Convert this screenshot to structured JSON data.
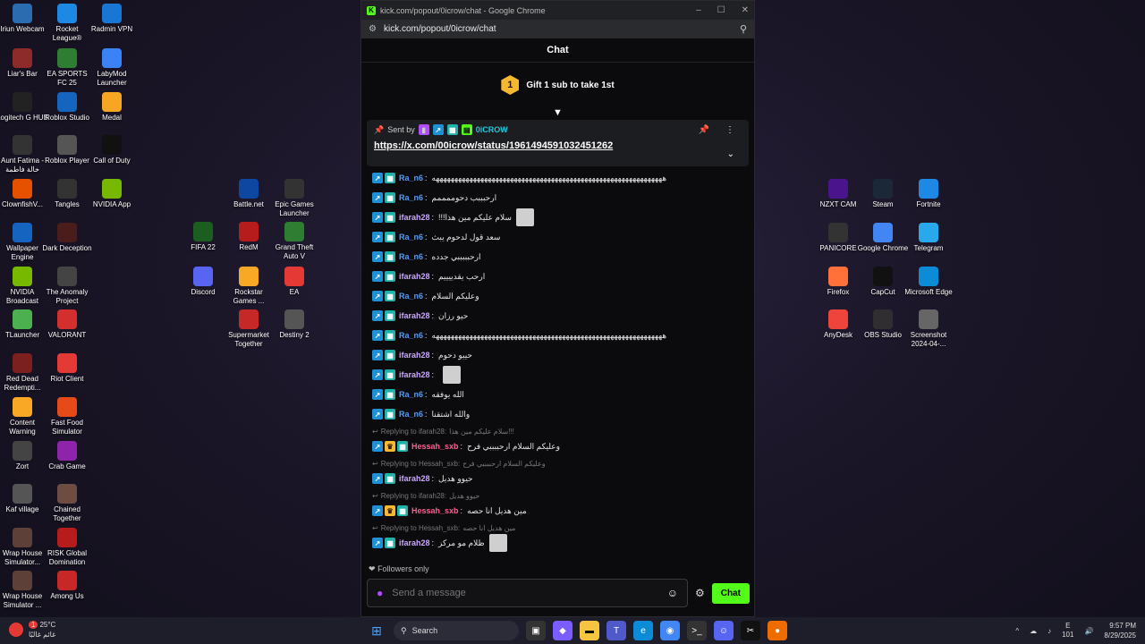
{
  "window": {
    "title": "kick.com/popout/0icrow/chat - Google Chrome",
    "url": "kick.com/popout/0icrow/chat",
    "controls": [
      "–",
      "☐",
      "✕"
    ]
  },
  "chat": {
    "header": "Chat",
    "gift_text": "Gift 1 sub to take 1st",
    "gift_rank": "1",
    "pinned": {
      "sent_by": "Sent by",
      "user": "0iCROW",
      "link": "https://x.com/00icrow/status/1961494591032451262"
    },
    "messages": [
      {
        "user": "Ra_n6",
        "cls": "u-ra",
        "badges": [
          "og",
          "sub"
        ],
        "text": "ههههههههههههههههههههههههههههههههههههههههههههههههههههههههههههههه"
      },
      {
        "user": "Ra_n6",
        "cls": "u-ra",
        "badges": [
          "og",
          "sub"
        ],
        "text": "ارحبببب دحوممممم"
      },
      {
        "user": "ifarah28",
        "cls": "u-if",
        "badges": [
          "og",
          "sub"
        ],
        "text": "سلام عليكم مين هذا!!!",
        "emote": true
      },
      {
        "user": "Ra_n6",
        "cls": "u-ra",
        "badges": [
          "og",
          "sub"
        ],
        "text": "سعد قول لدحوم يبث"
      },
      {
        "user": "Ra_n6",
        "cls": "u-ra",
        "badges": [
          "og",
          "sub"
        ],
        "text": "ارحبببببي جدده"
      },
      {
        "user": "ifarah28",
        "cls": "u-if",
        "badges": [
          "og",
          "sub"
        ],
        "text": "ارحب يقدييييم"
      },
      {
        "user": "Ra_n6",
        "cls": "u-ra",
        "badges": [
          "og",
          "sub"
        ],
        "text": "وعليكم السلام"
      },
      {
        "user": "ifarah28",
        "cls": "u-if",
        "badges": [
          "og",
          "sub"
        ],
        "text": "حيو رزان"
      },
      {
        "user": "Ra_n6",
        "cls": "u-ra",
        "badges": [
          "og",
          "sub"
        ],
        "text": "ههههههههههههههههههههههههههههههههههههههههههههههههههههههههههههههه"
      },
      {
        "user": "ifarah28",
        "cls": "u-if",
        "badges": [
          "og",
          "sub"
        ],
        "text": "حييو دحوم"
      },
      {
        "user": "ifarah28",
        "cls": "u-if",
        "badges": [
          "og",
          "sub"
        ],
        "text": "",
        "emote": true
      },
      {
        "user": "Ra_n6",
        "cls": "u-ra",
        "badges": [
          "og",
          "sub"
        ],
        "text": "الله يوفقه"
      },
      {
        "user": "Ra_n6",
        "cls": "u-ra",
        "badges": [
          "og",
          "sub"
        ],
        "text": "والله اشتقنا"
      },
      {
        "reply": "Replying to ifarah28:",
        "reply_text": "سلام عليكم مين هذا!!!",
        "user": "Hessah_sxb",
        "cls": "u-he",
        "badges": [
          "og",
          "crown",
          "sub"
        ],
        "text": "وعليكم السلام ارحببببي فرح"
      },
      {
        "reply": "Replying to Hessah_sxb:",
        "reply_text": "وعليكم السلام ارحببببي فرح",
        "user": "ifarah28",
        "cls": "u-if",
        "badges": [
          "og",
          "sub"
        ],
        "text": "حيوو هديل"
      },
      {
        "reply": "Replying to ifarah28:",
        "reply_text": "حيوو هديل",
        "user": "Hessah_sxb",
        "cls": "u-he",
        "badges": [
          "og",
          "crown",
          "sub"
        ],
        "text": "مين هديل انا حصه"
      },
      {
        "reply": "Replying to Hessah_sxb:",
        "reply_text": "مين هديل انا حصه",
        "user": "ifarah28",
        "cls": "u-if",
        "badges": [
          "og",
          "sub"
        ],
        "text": "ظلام مو مركز",
        "emote": true
      }
    ],
    "followers_only": "Followers only",
    "input_placeholder": "Send a message",
    "send_label": "Chat"
  },
  "desktop_icons": [
    {
      "label": "Iriun Webcam",
      "color": "#2b6cb0"
    },
    {
      "label": "Rocket League®",
      "color": "#1e88e5"
    },
    {
      "label": "Radmin VPN",
      "color": "#1976d2"
    },
    {
      "label": "Liar's Bar",
      "color": "#8d2a2a"
    },
    {
      "label": "EA SPORTS FC 25",
      "color": "#2e7d32"
    },
    {
      "label": "LabyMod Launcher",
      "color": "#3b82f6"
    },
    {
      "label": "Logitech G HUB",
      "color": "#222"
    },
    {
      "label": "Roblox Studio",
      "color": "#1565c0"
    },
    {
      "label": "Medal",
      "color": "#f5a623"
    },
    {
      "label": "Aunt Fatima - خالة فاطمة",
      "color": "#333"
    },
    {
      "label": "Roblox Player",
      "color": "#555"
    },
    {
      "label": "Call of Duty",
      "color": "#111"
    },
    {
      "label": "ClownfishV...",
      "color": "#e65100"
    },
    {
      "label": "Tangles",
      "color": "#333"
    },
    {
      "label": "NVIDIA App",
      "color": "#76b900"
    },
    {
      "label": "Wallpaper Engine",
      "color": "#1565c0"
    },
    {
      "label": "Dark Deception",
      "color": "#4a1c1c"
    },
    {
      "label": "NVIDIA Broadcast",
      "color": "#76b900"
    },
    {
      "label": "The Anomaly Project",
      "color": "#444"
    },
    {
      "label": "TLauncher",
      "color": "#4caf50"
    },
    {
      "label": "VALORANT",
      "color": "#d32f2f"
    },
    {
      "label": "Red Dead Redempti...",
      "color": "#7b1f1f"
    },
    {
      "label": "Riot Client",
      "color": "#e53935"
    },
    {
      "label": "Content Warning",
      "color": "#f9a825"
    },
    {
      "label": "Fast Food Simulator",
      "color": "#e64a19"
    },
    {
      "label": "Zort",
      "color": "#444"
    },
    {
      "label": "Crab Game",
      "color": "#8e24aa"
    },
    {
      "label": "Kaf village",
      "color": "#555"
    },
    {
      "label": "Chained Together",
      "color": "#6d4c41"
    },
    {
      "label": "Wrap House Simulator...",
      "color": "#5d4037"
    },
    {
      "label": "RISK Global Domination",
      "color": "#b71c1c"
    },
    {
      "label": "Wrap House Simulator ...",
      "color": "#5d4037"
    },
    {
      "label": "Among Us",
      "color": "#c62828"
    },
    {
      "label": "FIFA 22",
      "color": "#1b5e20"
    },
    {
      "label": "Battle.net",
      "color": "#0d47a1"
    },
    {
      "label": "Epic Games Launcher",
      "color": "#333"
    },
    {
      "label": "RedM",
      "color": "#b71c1c"
    },
    {
      "label": "Grand Theft Auto V",
      "color": "#2e7d32"
    },
    {
      "label": "Discord",
      "color": "#5865f2"
    },
    {
      "label": "Rockstar Games ...",
      "color": "#f9a825"
    },
    {
      "label": "EA",
      "color": "#e53935"
    },
    {
      "label": "Supermarket Together",
      "color": "#c62828"
    },
    {
      "label": "Destiny 2",
      "color": "#555"
    },
    {
      "label": "NZXT CAM",
      "color": "#4a148c"
    },
    {
      "label": "Steam",
      "color": "#1b2838"
    },
    {
      "label": "Fortnite",
      "color": "#1e88e5"
    },
    {
      "label": "PANICORE",
      "color": "#333"
    },
    {
      "label": "Google Chrome",
      "color": "#4285f4"
    },
    {
      "label": "Telegram",
      "color": "#29a9eb"
    },
    {
      "label": "Firefox",
      "color": "#ff7139"
    },
    {
      "label": "CapCut",
      "color": "#111"
    },
    {
      "label": "Microsoft Edge",
      "color": "#0c8bd6"
    },
    {
      "label": "AnyDesk",
      "color": "#ef443b"
    },
    {
      "label": "OBS Studio",
      "color": "#302e31"
    },
    {
      "label": "Screenshot 2024-04-...",
      "color": "#666"
    }
  ],
  "taskbar": {
    "weather_temp": "25°C",
    "weather_text": "غائم غالبًا",
    "weather_badge": "1",
    "search_label": "Search",
    "lang": "E",
    "lang_sub": "101",
    "time": "9:57 PM",
    "date": "8/29/2025"
  }
}
